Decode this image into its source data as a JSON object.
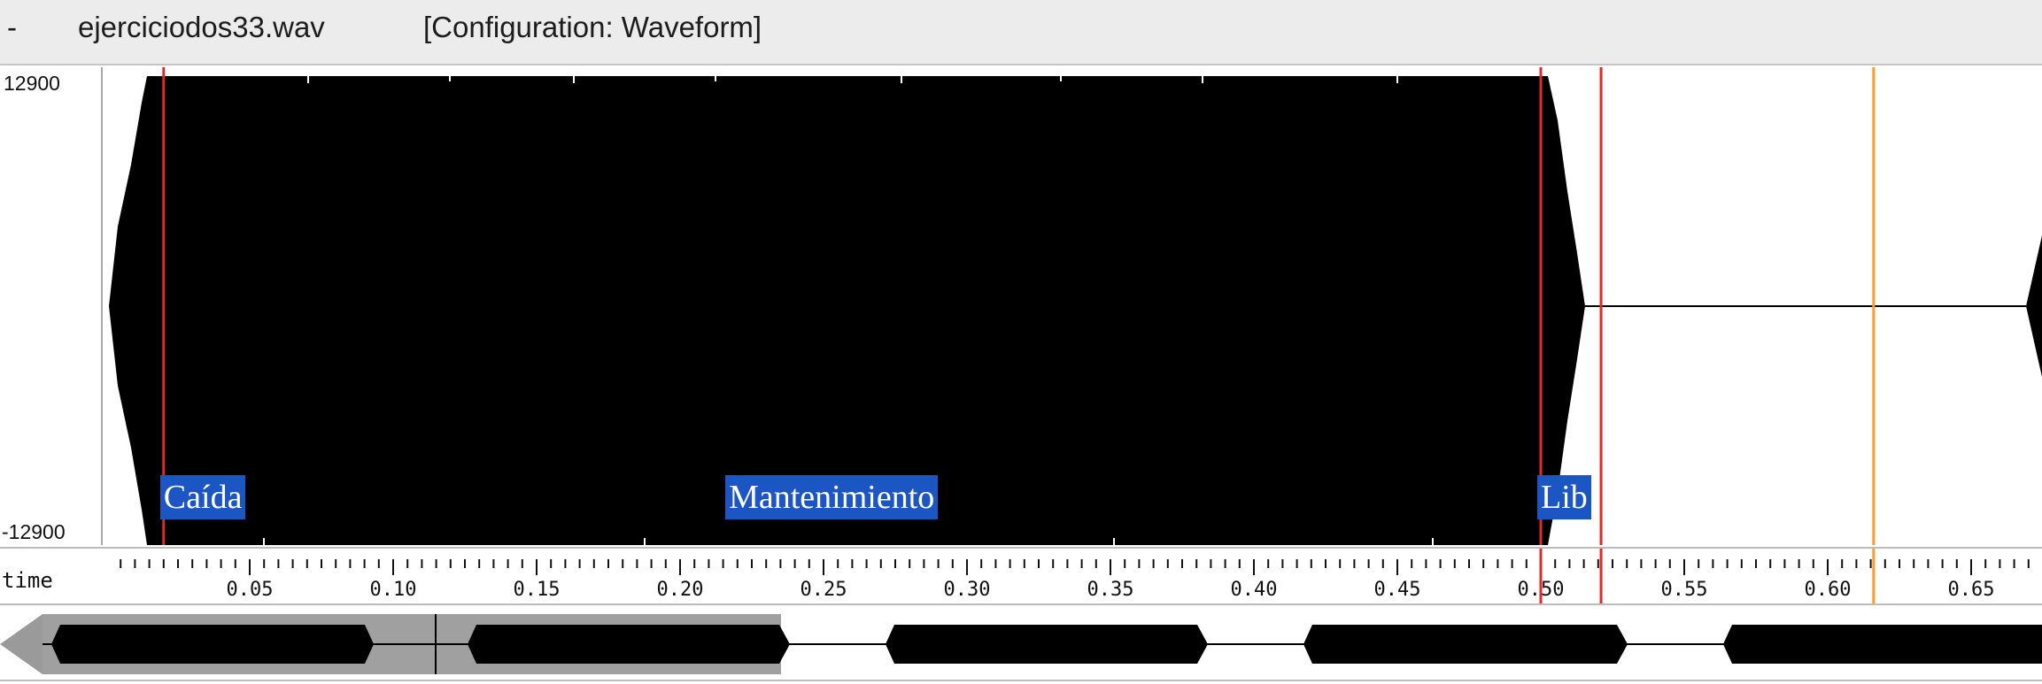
{
  "titlebar": {
    "dash": "-",
    "filename": "ejerciciodos33.wav",
    "configuration": "[Configuration: Waveform]"
  },
  "amplitude_axis": {
    "max_label": "12900",
    "min_label": "-12900"
  },
  "markers": [
    {
      "label": "Caída",
      "time": 0.02
    },
    {
      "label": "Mantenimiento",
      "time": 0.217
    },
    {
      "label": "Lib",
      "time": 0.5
    }
  ],
  "cursors": [
    {
      "time": 0.02,
      "color": "#e02a2a"
    },
    {
      "time": 0.5,
      "color": "#e02a2a"
    },
    {
      "time": 0.521,
      "color": "#e02a2a"
    },
    {
      "time": 0.616,
      "color": "#ff9a2e"
    }
  ],
  "timeline": {
    "label": "time",
    "ticks": [
      "0.05",
      "0.10",
      "0.15",
      "0.20",
      "0.25",
      "0.30",
      "0.35",
      "0.40",
      "0.45",
      "0.50",
      "0.55",
      "0.60",
      "0.65"
    ]
  },
  "overview": {
    "left_arrow_icon": "triangle-left"
  },
  "colors": {
    "waveform": "#000000",
    "marker_bg": "#1b56c4",
    "marker_text": "#ffffff",
    "cursor_red": "#e02a2a",
    "cursor_orange": "#ff9a2e",
    "overview_shade": "#a0a0a0"
  }
}
